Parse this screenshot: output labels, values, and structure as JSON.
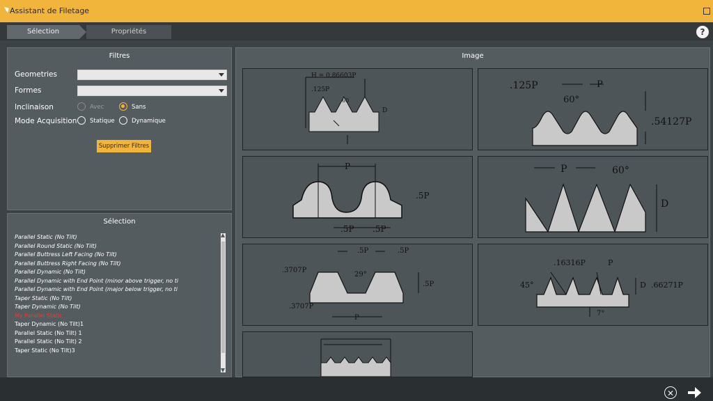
{
  "window": {
    "title": "Assistant de Filetage"
  },
  "tabs": [
    {
      "label": "Sélection"
    },
    {
      "label": "Propriétés"
    }
  ],
  "filters": {
    "header": "Filtres",
    "geometry_label": "Geometries",
    "forms_label": "Formes",
    "inclination_label": "Inclinaison",
    "inclination_options": {
      "avec": "Avec",
      "sans": "Sans"
    },
    "inclination_selected": "Sans",
    "acquisition_label": "Mode Acquisition",
    "acquisition_options": {
      "statique": "Statique",
      "dynamique": "Dynamique"
    },
    "clear_button": "Supprimer Filtres"
  },
  "selection": {
    "header": "Sélection",
    "items": [
      {
        "label": "Parallel Static (No Tilt)"
      },
      {
        "label": "Parallel Round Static (No Tilt)"
      },
      {
        "label": "Parallel Buttress Left Facing (No Tilt)"
      },
      {
        "label": "Parallel Buttress Right Facing (No Tilt)"
      },
      {
        "label": "Parallel Dynamic (No Tilt)"
      },
      {
        "label": "Parallel Dynamic with End Point (minor above trigger, no ti"
      },
      {
        "label": "Parallel Dynamic with End Point (major below trigger, no ti"
      },
      {
        "label": "Taper Static (No Tilt)"
      },
      {
        "label": "Taper Dynamic (No Tilt)"
      },
      {
        "label": "My Parallel Static"
      },
      {
        "label": "Taper Dynamic (No Tilt)1"
      },
      {
        "label": "Parallel Static (No Tilt) 1"
      },
      {
        "label": "Parallel Static (No Tilt) 2"
      },
      {
        "label": "Taper Static (No Tilt)3"
      }
    ]
  },
  "images": {
    "header": "Image",
    "labels": {
      "d1": "H = 0.86603P",
      "d1b": ".125P",
      "d1c": "60",
      "d1d": "D",
      "d2a": ".125P",
      "d2b": "P",
      "d2c": "60°",
      "d2d": ".54127P",
      "d3a": "P",
      "d3b": ".5P",
      "d3c": ".5P",
      "d3d": ".5P",
      "d4a": "P",
      "d4b": "60°",
      "d4c": "D",
      "d5a": ".5P",
      "d5b": ".5P",
      "d5c": ".3707P",
      "d5d": "29°",
      "d5e": ".5P",
      "d5f": ".3707P",
      "d5g": "P",
      "d6a": ".16316P",
      "d6b": "P",
      "d6c": "45°",
      "d6d": "D",
      "d6e": ".66271P",
      "d6f": "7°"
    }
  },
  "colors": {
    "accent": "#f0b53a",
    "panel": "#555c60",
    "background": "#3c4245",
    "highlight_item": "#e23b3b"
  },
  "icons": {
    "help": "question-circle-icon",
    "close": "close-circle-icon",
    "next": "arrow-right-icon"
  }
}
